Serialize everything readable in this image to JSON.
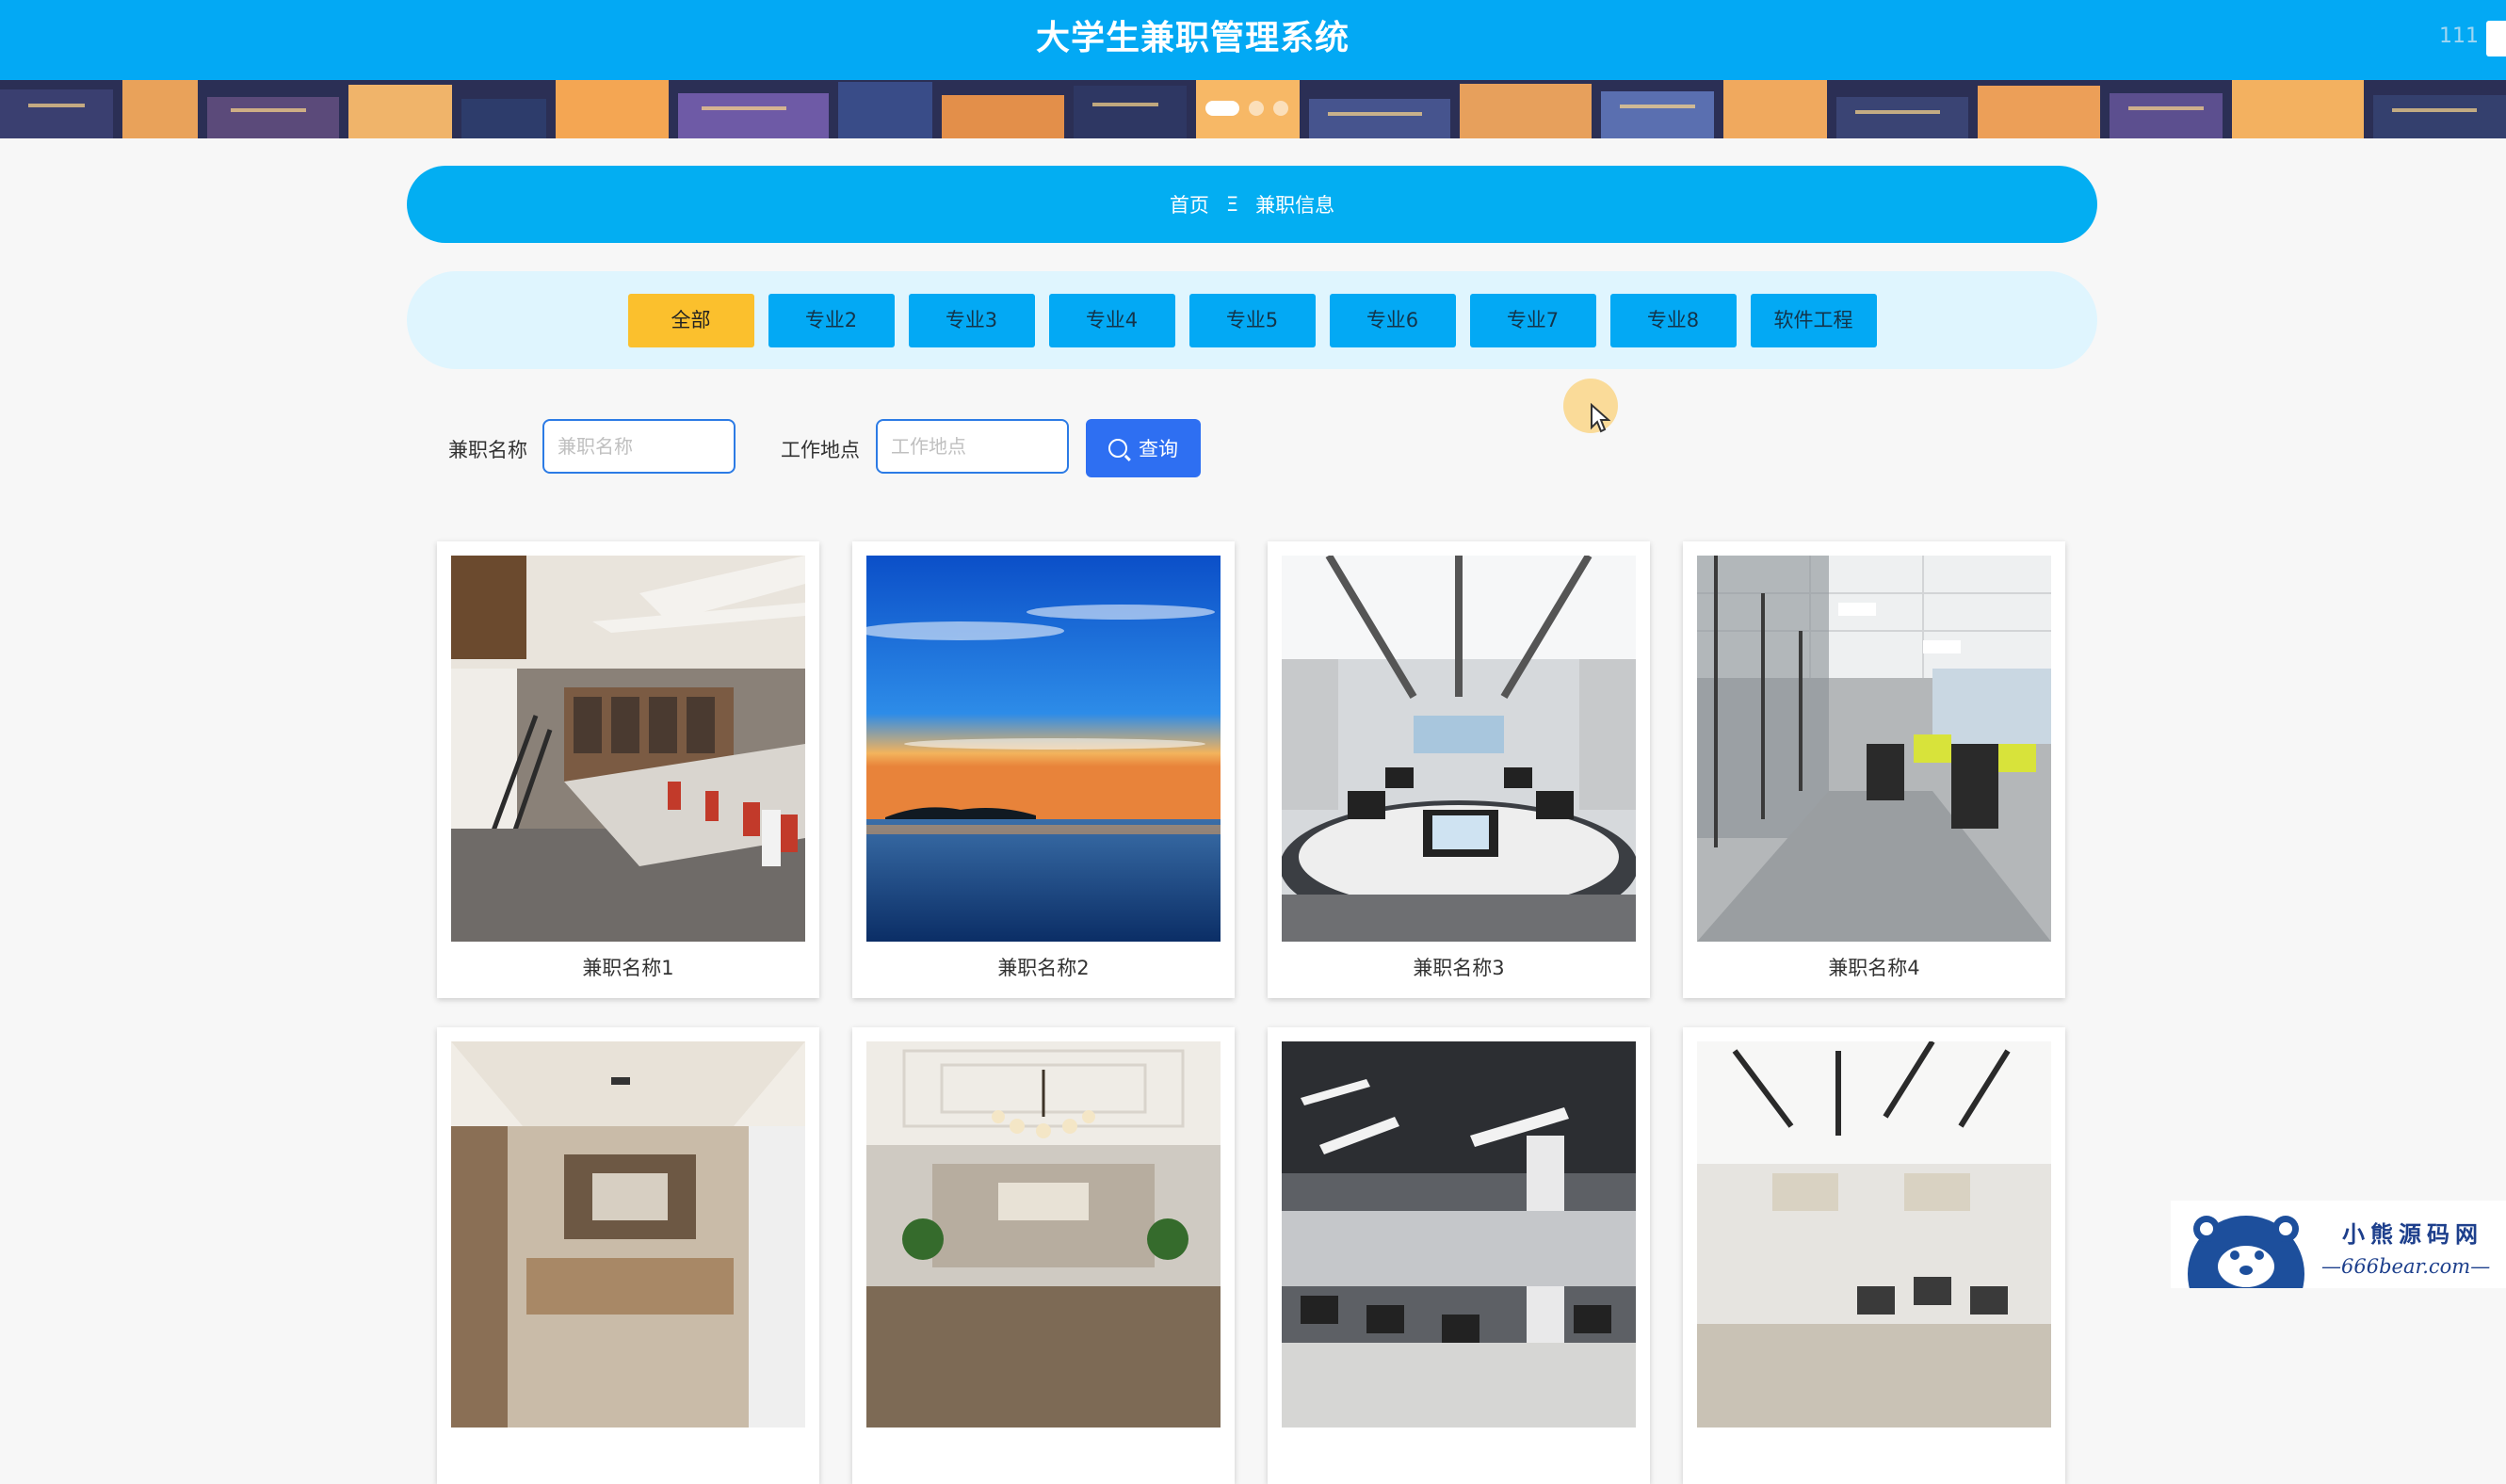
{
  "header": {
    "title": "大学生兼职管理系统",
    "user": "111"
  },
  "breadcrumb": {
    "home": "首页",
    "separator": "Ξ",
    "current": "兼职信息"
  },
  "filters": [
    {
      "label": "全部",
      "active": true
    },
    {
      "label": "专业2",
      "active": false
    },
    {
      "label": "专业3",
      "active": false
    },
    {
      "label": "专业4",
      "active": false
    },
    {
      "label": "专业5",
      "active": false
    },
    {
      "label": "专业6",
      "active": false
    },
    {
      "label": "专业7",
      "active": false
    },
    {
      "label": "专业8",
      "active": false
    },
    {
      "label": "软件工程",
      "active": false
    }
  ],
  "search": {
    "name_label": "兼职名称",
    "name_placeholder": "兼职名称",
    "location_label": "工作地点",
    "location_placeholder": "工作地点",
    "button_label": "查询"
  },
  "cards": [
    {
      "name": "兼职名称1",
      "image": "office-loft-photo"
    },
    {
      "name": "兼职名称2",
      "image": "lake-sunset-photo"
    },
    {
      "name": "兼职名称3",
      "image": "computer-classroom-photo"
    },
    {
      "name": "兼职名称4",
      "image": "office-corridor-photo"
    },
    {
      "name": "",
      "image": "executive-office-photo"
    },
    {
      "name": "",
      "image": "chandelier-meeting-room-photo"
    },
    {
      "name": "",
      "image": "dark-open-office-photo"
    },
    {
      "name": "",
      "image": "bright-open-office-photo"
    }
  ],
  "watermark": {
    "line1": "小熊源码网",
    "line2": "—666bear.com—"
  },
  "colors": {
    "primary": "#03a9f4",
    "active_tab": "#fbc02d",
    "search_button": "#2e6ff2"
  }
}
